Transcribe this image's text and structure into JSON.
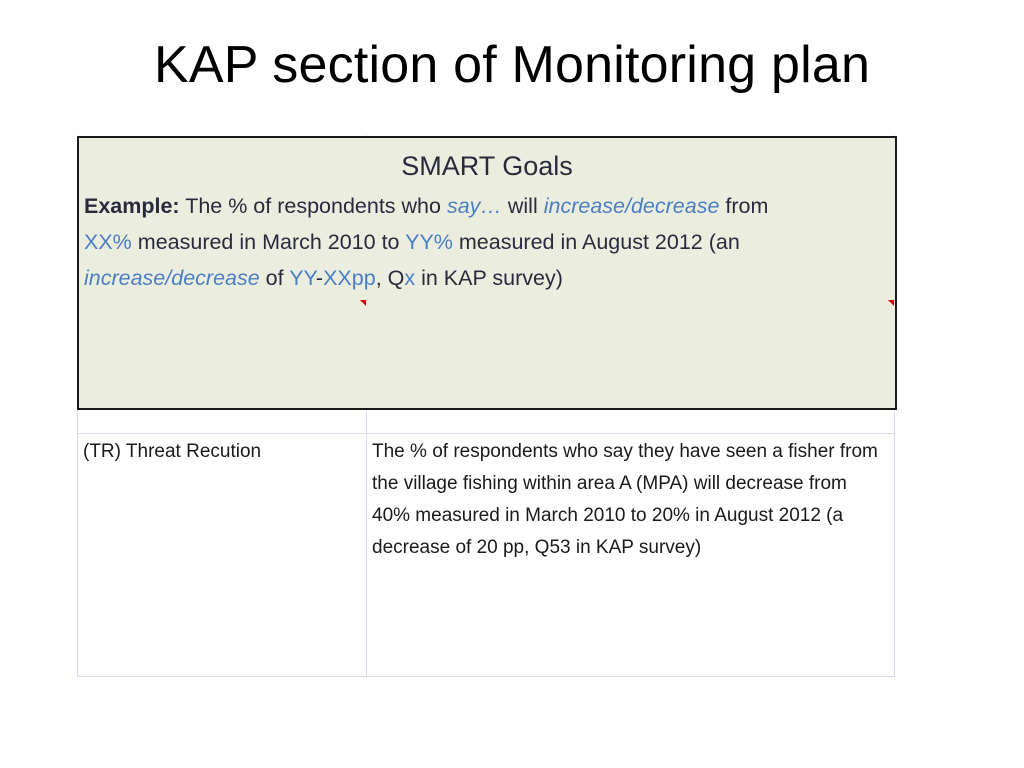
{
  "slide": {
    "title": "KAP section of Monitoring plan"
  },
  "smart_goals": {
    "heading": "SMART Goals",
    "example": {
      "label": "Example:",
      "t1": " The % of respondents who ",
      "say": "say…",
      "t2": "  will ",
      "incdec1": "increase/decrease",
      "t3": "  from ",
      "xx_pct": "XX%",
      "t4": " measured in March 2010 to ",
      "yy_pct": "YY%",
      "t5": " measured in August 2012 (an ",
      "incdec2": "increase/decrease",
      "t6": "  of ",
      "yy": "YY",
      "dash": "-",
      "xxpp": "XXpp",
      "t7": ", Q",
      "x": "x",
      "t8": "  in KAP survey)"
    }
  },
  "table": {
    "rows": [
      {
        "category": "(TR) Threat Recution",
        "goal": "The % of respondents who say they have seen a fisher from the village fishing within area A (MPA) will decrease from 40% measured in March 2010 to 20% in August 2012 (a decrease of 20 pp, Q53 in KAP survey)"
      }
    ]
  },
  "colors": {
    "placeholder": "#4a7ec4",
    "smart_box_bg": "#ebeedf",
    "grid_line": "#d9d9ef",
    "comment_marker": "#e00000"
  }
}
